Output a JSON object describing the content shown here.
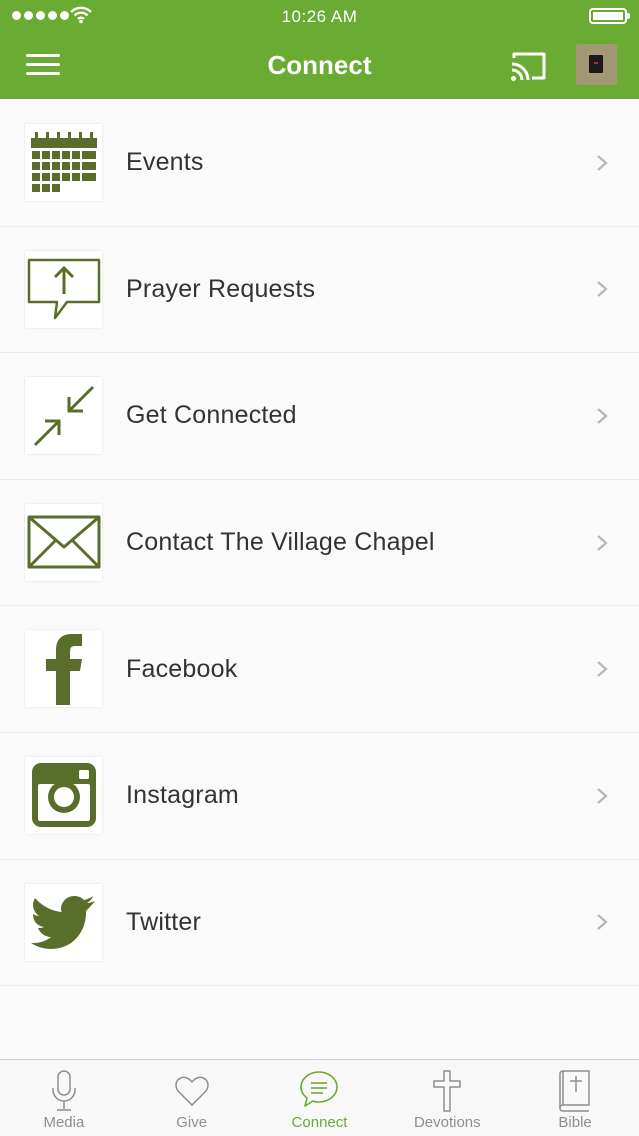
{
  "status_bar": {
    "time": "10:26 AM"
  },
  "header": {
    "title": "Connect"
  },
  "colors": {
    "brand": "#6aab33",
    "icon": "#5a6e2c",
    "text": "#333333",
    "tab_inactive": "#8e8e8e"
  },
  "list": {
    "items": [
      {
        "label": "Events",
        "icon": "calendar-icon"
      },
      {
        "label": "Prayer Requests",
        "icon": "prayer-bubble-icon"
      },
      {
        "label": "Get Connected",
        "icon": "arrows-in-icon"
      },
      {
        "label": "Contact The Village Chapel",
        "icon": "envelope-icon"
      },
      {
        "label": "Facebook",
        "icon": "facebook-icon"
      },
      {
        "label": "Instagram",
        "icon": "instagram-icon"
      },
      {
        "label": "Twitter",
        "icon": "twitter-icon"
      }
    ]
  },
  "tabbar": {
    "tabs": [
      {
        "label": "Media",
        "icon": "microphone-icon"
      },
      {
        "label": "Give",
        "icon": "heart-icon"
      },
      {
        "label": "Connect",
        "icon": "chat-icon",
        "active": true
      },
      {
        "label": "Devotions",
        "icon": "cross-icon"
      },
      {
        "label": "Bible",
        "icon": "bible-icon"
      }
    ]
  }
}
